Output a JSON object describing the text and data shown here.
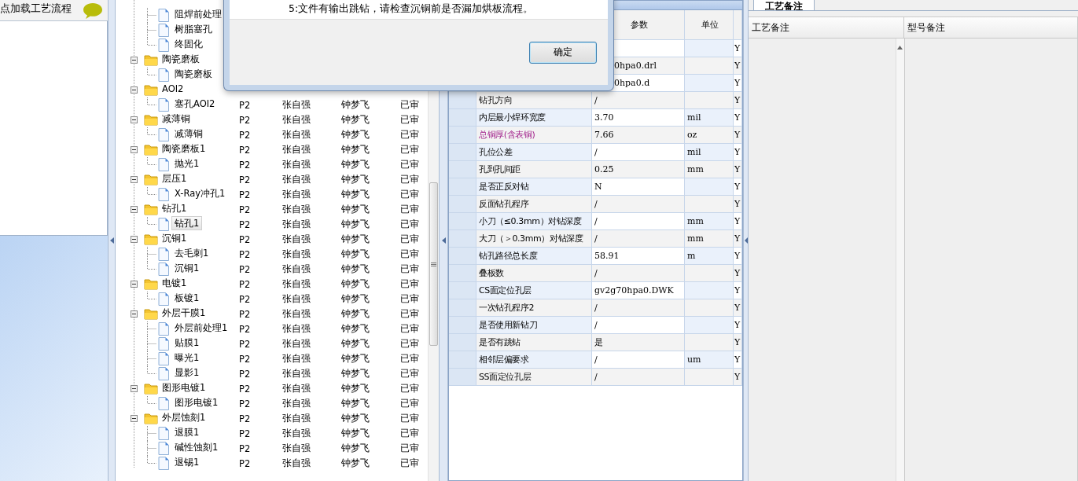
{
  "left_panel": {
    "title": "点加载工艺流程"
  },
  "tree": {
    "groups": [
      {
        "children": [
          {
            "label": "阻焊前处理",
            "selected": false
          },
          {
            "label": "树脂塞孔",
            "selected": false
          },
          {
            "label": "终固化",
            "selected": false
          }
        ]
      },
      {
        "label": "陶瓷磨板",
        "expanded": true,
        "selected": false,
        "children": [
          {
            "label": "陶瓷磨板",
            "selected": false
          }
        ]
      },
      {
        "label": "AOI2",
        "expanded": true,
        "selected": false,
        "children": [
          {
            "label": "塞孔AOI2",
            "selected": false,
            "cells": [
              "P2",
              "张自强",
              "钟梦飞",
              "已审"
            ]
          }
        ]
      },
      {
        "label": "减薄铜",
        "expanded": true,
        "selected": false,
        "cells": [
          "P2",
          "张自强",
          "钟梦飞",
          "已审"
        ],
        "children": [
          {
            "label": "减薄铜",
            "selected": false,
            "cells": [
              "P2",
              "张自强",
              "钟梦飞",
              "已审"
            ]
          }
        ]
      },
      {
        "label": "陶瓷磨板1",
        "expanded": true,
        "selected": false,
        "cells": [
          "P2",
          "张自强",
          "钟梦飞",
          "已审"
        ],
        "children": [
          {
            "label": "抛光1",
            "selected": false,
            "cells": [
              "P2",
              "张自强",
              "钟梦飞",
              "已审"
            ]
          }
        ]
      },
      {
        "label": "层压1",
        "expanded": true,
        "selected": false,
        "cells": [
          "P2",
          "张自强",
          "钟梦飞",
          "已审"
        ],
        "children": [
          {
            "label": "X-Ray冲孔1",
            "selected": false,
            "cells": [
              "P2",
              "张自强",
              "钟梦飞",
              "已审"
            ]
          }
        ]
      },
      {
        "label": "钻孔1",
        "expanded": true,
        "selected": false,
        "cells": [
          "P2",
          "张自强",
          "钟梦飞",
          "已审"
        ],
        "children": [
          {
            "label": "钻孔1",
            "selected": true,
            "cells": [
              "P2",
              "张自强",
              "钟梦飞",
              "已审"
            ]
          }
        ]
      },
      {
        "label": "沉铜1",
        "expanded": true,
        "selected": false,
        "cells": [
          "P2",
          "张自强",
          "钟梦飞",
          "已审"
        ],
        "children": [
          {
            "label": "去毛刺1",
            "selected": false,
            "cells": [
              "P2",
              "张自强",
              "钟梦飞",
              "已审"
            ]
          },
          {
            "label": "沉铜1",
            "selected": false,
            "cells": [
              "P2",
              "张自强",
              "钟梦飞",
              "已审"
            ]
          }
        ]
      },
      {
        "label": "电镀1",
        "expanded": true,
        "selected": false,
        "cells": [
          "P2",
          "张自强",
          "钟梦飞",
          "已审"
        ],
        "children": [
          {
            "label": "板镀1",
            "selected": false,
            "cells": [
              "P2",
              "张自强",
              "钟梦飞",
              "已审"
            ]
          }
        ]
      },
      {
        "label": "外层干膜1",
        "expanded": true,
        "selected": false,
        "cells": [
          "P2",
          "张自强",
          "钟梦飞",
          "已审"
        ],
        "children": [
          {
            "label": "外层前处理1",
            "selected": false,
            "cells": [
              "P2",
              "张自强",
              "钟梦飞",
              "已审"
            ]
          },
          {
            "label": "贴膜1",
            "selected": false,
            "cells": [
              "P2",
              "张自强",
              "钟梦飞",
              "已审"
            ]
          },
          {
            "label": "曝光1",
            "selected": false,
            "cells": [
              "P2",
              "张自强",
              "钟梦飞",
              "已审"
            ]
          },
          {
            "label": "显影1",
            "selected": false,
            "cells": [
              "P2",
              "张自强",
              "钟梦飞",
              "已审"
            ]
          }
        ]
      },
      {
        "label": "图形电镀1",
        "expanded": true,
        "selected": false,
        "cells": [
          "P2",
          "张自强",
          "钟梦飞",
          "已审"
        ],
        "children": [
          {
            "label": "图形电镀1",
            "selected": false,
            "cells": [
              "P2",
              "张自强",
              "钟梦飞",
              "已审"
            ]
          }
        ]
      },
      {
        "label": "外层蚀刻1",
        "expanded": true,
        "selected": false,
        "cells": [
          "P2",
          "张自强",
          "钟梦飞",
          "已审"
        ],
        "children": [
          {
            "label": "退膜1",
            "selected": false,
            "cells": [
              "P2",
              "张自强",
              "钟梦飞",
              "已审"
            ]
          },
          {
            "label": "碱性蚀刻1",
            "selected": false,
            "cells": [
              "P2",
              "张自强",
              "钟梦飞",
              "已审"
            ]
          },
          {
            "label": "退锡1",
            "selected": false,
            "cells": [
              "P2",
              "张自强",
              "钟梦飞",
              "已审"
            ]
          }
        ]
      }
    ]
  },
  "dialog": {
    "message": "5:文件有输出跳钻，请检查沉铜前是否漏加烘板流程。",
    "button": "确定"
  },
  "grid": {
    "columns": [
      "参数",
      "单位"
    ],
    "rows": [
      {
        "flag": "Y"
      },
      {
        "value": "0hpa0.drl",
        "cut": true,
        "flag": "Y"
      },
      {
        "value": "0hpa0.d",
        "cut": true,
        "flag": "Y"
      },
      {
        "name": "钻孔方向",
        "value": "/",
        "flag": "Y"
      },
      {
        "name": "内层最小焊环宽度",
        "value": "3.70",
        "unit": "mil",
        "flag": "Y"
      },
      {
        "name": "总铜厚(含表铜)",
        "value": "7.66",
        "unit": "oz",
        "highlight": true,
        "flag": "Y"
      },
      {
        "name": "孔位公差",
        "value": "/",
        "unit": "mil",
        "flag": "Y"
      },
      {
        "name": "孔到孔间距",
        "value": "0.25",
        "unit": "mm",
        "flag": "Y"
      },
      {
        "name": "是否正反对钻",
        "value": "N",
        "flag": "Y"
      },
      {
        "name": "反面钻孔程序",
        "value": "/",
        "flag": "Y"
      },
      {
        "name": "小刀（≤0.3mm）对钻深度",
        "value": "/",
        "unit": "mm",
        "flag": "Y"
      },
      {
        "name": "大刀（＞0.3mm）对钻深度",
        "value": "/",
        "unit": "mm",
        "flag": "Y"
      },
      {
        "name": "钻孔路径总长度",
        "value": "58.91",
        "unit": "m",
        "flag": "Y"
      },
      {
        "name": "叠板数",
        "value": "/",
        "flag": "Y"
      },
      {
        "name": "CS面定位孔层",
        "value": "gv2g70hpa0.DWK",
        "flag": "Y"
      },
      {
        "name": "一次钻孔程序2",
        "value": "/",
        "flag": "Y"
      },
      {
        "name": "是否使用新钻刀",
        "value": "/",
        "flag": "Y"
      },
      {
        "name": "是否有跳钻",
        "value": "是",
        "flag": "Y"
      },
      {
        "name": "相邻层偏要求",
        "value": "/",
        "unit": "um",
        "flag": "Y"
      },
      {
        "name": "SS面定位孔层",
        "value": "/",
        "flag": "Y"
      }
    ]
  },
  "notes": {
    "tab": "工艺备注",
    "columns": [
      "工艺备注",
      "型号备注"
    ]
  }
}
